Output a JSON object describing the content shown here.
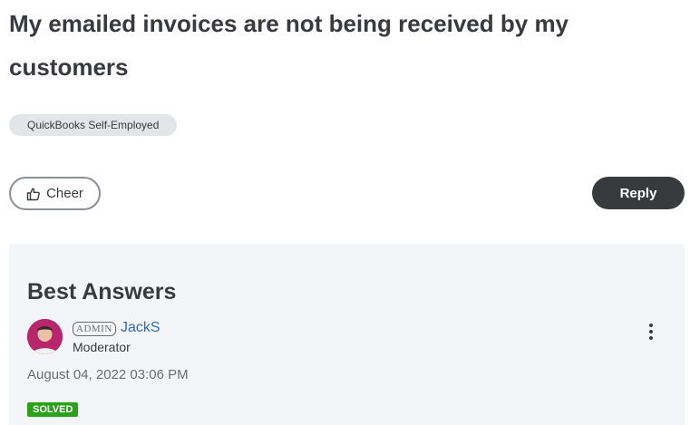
{
  "post": {
    "title": "My emailed invoices are not being received by my customers",
    "tag": "QuickBooks Self-Employed"
  },
  "actions": {
    "cheer_label": "Cheer",
    "reply_label": "Reply"
  },
  "best_answers": {
    "heading": "Best Answers",
    "author": {
      "badge": "ADMIN",
      "name": "JackS",
      "role": "Moderator"
    },
    "timestamp": "August 04, 2022 03:06 PM",
    "status_badge": "SOLVED",
    "status_color": "#2ca01c"
  },
  "icons": {
    "cheer": "thumbs-up-icon",
    "menu": "more-vertical-icon"
  },
  "colors": {
    "reply_button": "#393a3d",
    "link": "#2e6bb7",
    "panel_bg": "#f4f5f8"
  }
}
